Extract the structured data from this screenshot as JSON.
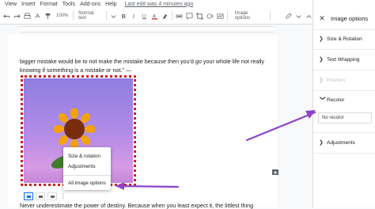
{
  "menubar": {
    "items": [
      "View",
      "Insert",
      "Format",
      "Tools",
      "Add-ons",
      "Help"
    ],
    "last_edit": "Last edit was 4 minutes ago"
  },
  "toolbar": {
    "zoom": "100%",
    "style": "Normal text",
    "image_options_label": "Image options",
    "accent_text_color": "#d93025"
  },
  "document": {
    "paragraph": "bigger mistake would be to not make the mistake because then you'd go your whole life not really knowing if something is a mistake or not.\" —",
    "bottom_text": "Never underestimate the power of destiny. Because when you least expect it, the littlest thing"
  },
  "popup": {
    "items": [
      "Size & rotation",
      "Adjustments",
      "All image options"
    ]
  },
  "sidebar": {
    "title": "Image options",
    "sections": [
      "Size & Rotation",
      "Text Wrapping",
      "Position",
      "Recolor",
      "Adjustments"
    ],
    "recolor_value": "No recolor"
  },
  "colors": {
    "annotation_arrow": "#8e44c9",
    "selection_dots": "#d41c1c",
    "accent": "#1a73e8"
  }
}
